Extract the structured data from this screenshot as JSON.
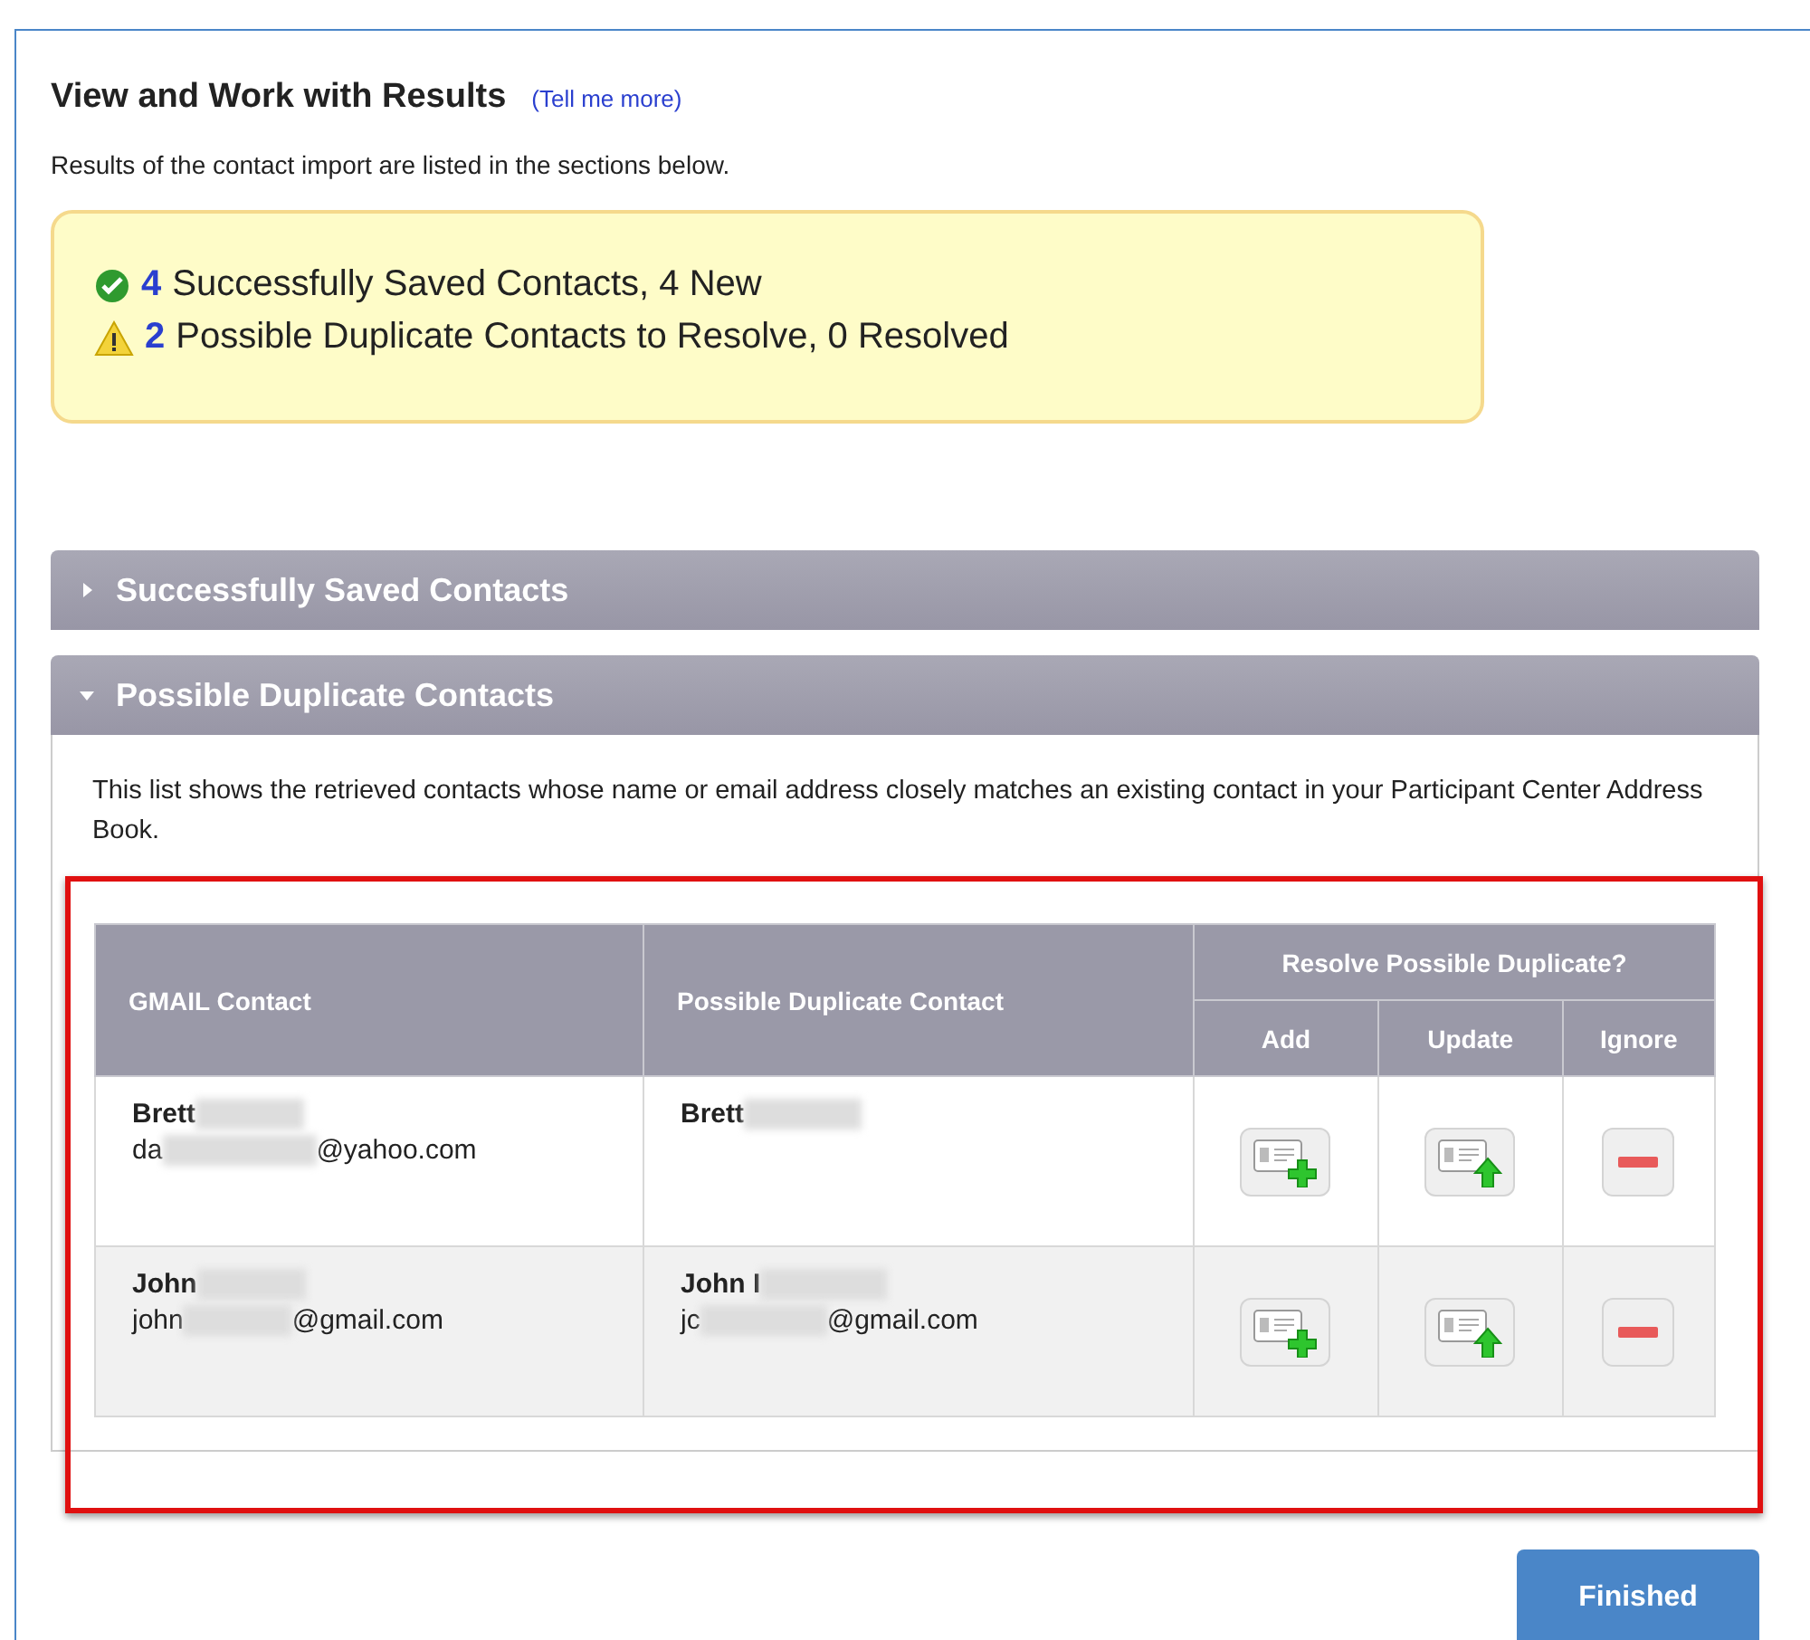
{
  "title": "View and Work with Results",
  "help_link": "(Tell me more)",
  "intro": "Results of the contact import are listed in the sections below.",
  "summary": [
    {
      "kind": "success",
      "count": "4",
      "text": "Successfully Saved Contacts, 4 New"
    },
    {
      "kind": "warning",
      "count": "2",
      "text": "Possible Duplicate Contacts to Resolve, 0 Resolved"
    }
  ],
  "sections": [
    {
      "title": "Successfully Saved Contacts",
      "expanded": false
    },
    {
      "title": "Possible Duplicate Contacts",
      "expanded": true,
      "description": "This list shows the retrieved contacts whose name or email address closely matches an existing contact in your Participant Center Address Book.",
      "table": {
        "columns": [
          "GMAIL Contact",
          "Possible Duplicate Contact"
        ],
        "group_header": "Resolve Possible Duplicate?",
        "actions": [
          "Add",
          "Update",
          "Ignore"
        ],
        "rows": [
          {
            "contact": {
              "name": "Brett",
              "email_start": "da",
              "email_end": "@yahoo.com"
            },
            "duplicate": {
              "name": "Brett"
            }
          },
          {
            "contact": {
              "name": "John",
              "email_start": "john",
              "email_end": "@gmail.com"
            },
            "duplicate": {
              "name": "John I",
              "email_start": "jc",
              "email_end": "@gmail.com"
            }
          }
        ]
      }
    }
  ],
  "finish_button": "Finished"
}
